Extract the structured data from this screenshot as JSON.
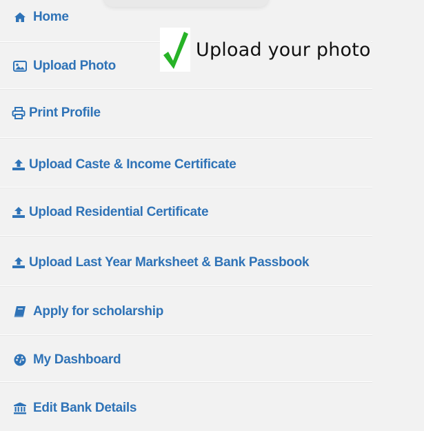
{
  "menu": {
    "items": [
      {
        "label": "Home",
        "icon": "home-icon"
      },
      {
        "label": "Upload Photo",
        "icon": "image-icon"
      },
      {
        "label": "Print Profile",
        "icon": "print-icon"
      },
      {
        "label": "Upload Caste & Income Certificate",
        "icon": "upload-icon"
      },
      {
        "label": "Upload Residential Certificate",
        "icon": "upload-icon"
      },
      {
        "label": "Upload Last Year Marksheet & Bank Passbook",
        "icon": "upload-icon"
      },
      {
        "label": "Apply for scholarship",
        "icon": "book-icon"
      },
      {
        "label": "My Dashboard",
        "icon": "dashboard-icon"
      },
      {
        "label": "Edit Bank Details",
        "icon": "bank-icon"
      }
    ]
  },
  "annotation": {
    "text": "Upload your photo",
    "icon": "checkmark-icon"
  },
  "colors": {
    "link": "#2f73b7",
    "check": "#27b327",
    "background": "#f2f2f2"
  }
}
